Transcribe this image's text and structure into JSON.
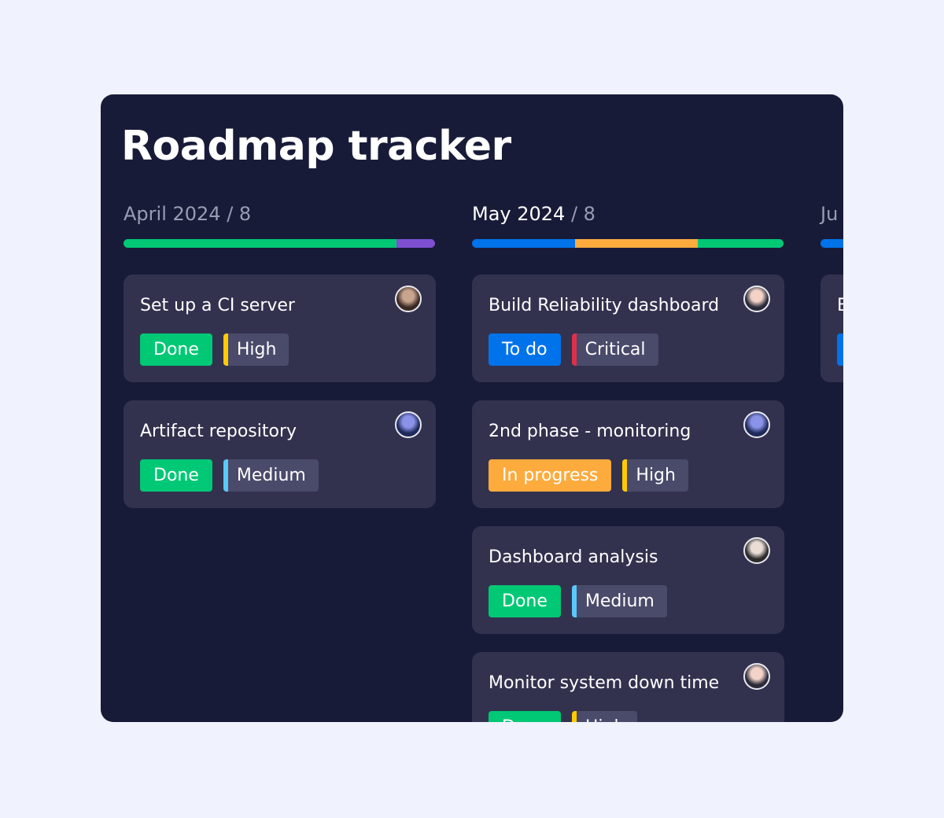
{
  "title": "Roadmap tracker",
  "columns": [
    {
      "month": "April 2024",
      "count": "/ 8",
      "active": false,
      "bar": [
        {
          "color": "#00c875",
          "share": 0.875
        },
        {
          "color": "#7e4fd0",
          "share": 0.125
        }
      ],
      "cards": [
        {
          "title": "Set up a CI server",
          "status": "Done",
          "status_color": "#00c875",
          "priority": "High",
          "priority_color": "#ffcb00",
          "avatar": [
            "#c9a48e",
            "#3a2a24"
          ]
        },
        {
          "title": "Artifact repository",
          "status": "Done",
          "status_color": "#00c875",
          "priority": "Medium",
          "priority_color": "#5ac8fa",
          "avatar": [
            "#8b93e8",
            "#1e2a5a"
          ]
        }
      ]
    },
    {
      "month": "May 2024",
      "count": "/ 8",
      "active": true,
      "bar": [
        {
          "color": "#0073ea",
          "share": 0.33
        },
        {
          "color": "#fdab3d",
          "share": 0.395
        },
        {
          "color": "#00c875",
          "share": 0.275
        }
      ],
      "cards": [
        {
          "title": "Build Reliability dashboard",
          "status": "To do",
          "status_color": "#0073ea",
          "priority": "Critical",
          "priority_color": "#df2f4a",
          "avatar": [
            "#f3d3c8",
            "#2a2a3a"
          ]
        },
        {
          "title": "2nd phase - monitoring",
          "status": "In progress",
          "status_color": "#fdab3d",
          "priority": "High",
          "priority_color": "#ffcb00",
          "avatar": [
            "#8b93e8",
            "#1e2a5a"
          ]
        },
        {
          "title": "Dashboard analysis",
          "status": "Done",
          "status_color": "#00c875",
          "priority": "Medium",
          "priority_color": "#5ac8fa",
          "avatar": [
            "#e9ddd6",
            "#2b2b2b"
          ]
        },
        {
          "title": "Monitor system down time",
          "status": "Done",
          "status_color": "#00c875",
          "priority": "High",
          "priority_color": "#ffcb00",
          "avatar": [
            "#f3d3c8",
            "#2a2a3a"
          ]
        }
      ]
    },
    {
      "month": "Ju",
      "count": "",
      "active": false,
      "bar": [
        {
          "color": "#0073ea",
          "share": 1
        }
      ],
      "cards": [
        {
          "title": "B",
          "status": "",
          "status_color": "#0073ea",
          "priority": "",
          "priority_color": "#4a4b6a",
          "avatar": [
            "#32324f",
            "#32324f"
          ]
        }
      ]
    }
  ]
}
